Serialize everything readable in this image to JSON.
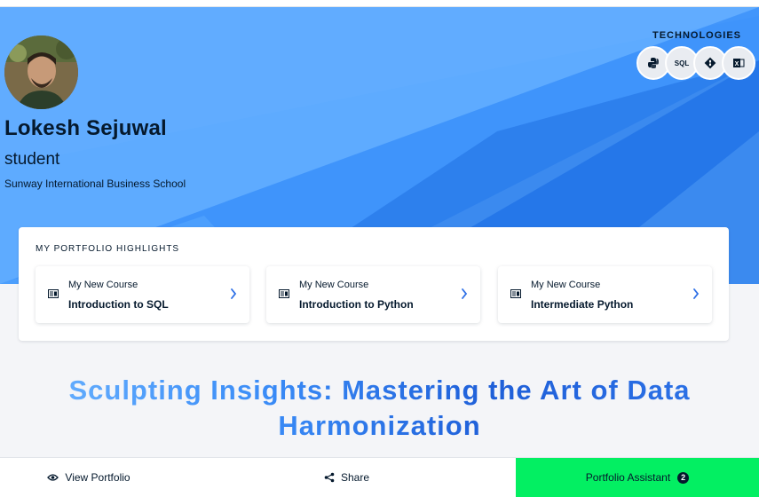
{
  "profile": {
    "name": "Lokesh Sejuwal",
    "role": "student",
    "organization": "Sunway International Business School"
  },
  "technologies": {
    "title": "TECHNOLOGIES",
    "items": [
      {
        "name": "Python",
        "icon": "python-icon",
        "glyph": "⛬"
      },
      {
        "name": "SQL",
        "icon": "sql-icon",
        "glyph": "SQL"
      },
      {
        "name": "Git",
        "icon": "git-icon",
        "glyph": "◆"
      },
      {
        "name": "Excel",
        "icon": "excel-icon",
        "glyph": "X"
      }
    ]
  },
  "highlights": {
    "title": "MY PORTFOLIO HIGHLIGHTS",
    "cards": [
      {
        "kind": "My New Course",
        "title": "Introduction to SQL"
      },
      {
        "kind": "My New Course",
        "title": "Introduction to Python"
      },
      {
        "kind": "My New Course",
        "title": "Intermediate Python"
      }
    ]
  },
  "headline": {
    "line1": "Sculpting Insights: Mastering the Art of Data",
    "line2": "Harmonization"
  },
  "bottom_bar": {
    "view_label": "View Portfolio",
    "share_label": "Share",
    "assistant_label": "Portfolio Assistant",
    "assistant_badge": "2"
  },
  "colors": {
    "accent_green": "#03ef62",
    "hero_blue": "#3a8cf7",
    "navy": "#05192d"
  }
}
